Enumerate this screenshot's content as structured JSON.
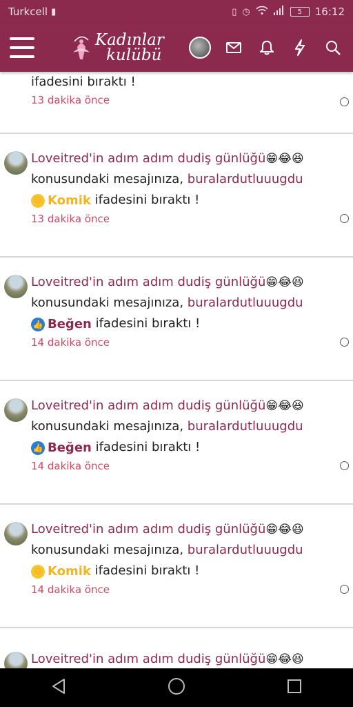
{
  "status": {
    "carrier": "Turkcell",
    "battery": "5",
    "time": "16:12"
  },
  "app": {
    "logo_line1": "Kadınlar",
    "logo_line2": "kulübü"
  },
  "feed": {
    "partial_text": "ifadesini bıraktı !",
    "partial_time": "13 dakika önce",
    "items": [
      {
        "title": "Loveitred'in adım adım dudiş günlüğü",
        "emojis": "😁😂😆",
        "middle": "konusundaki mesajınıza,",
        "user": "buralardutluuugdu",
        "reaction": "Komik",
        "reaction_type": "laugh",
        "suffix": "ifadesini bıraktı !",
        "time": "13 dakika önce"
      },
      {
        "title": "Loveitred'in adım adım dudiş günlüğü",
        "emojis": "😁😂😆",
        "middle": "konusundaki mesajınıza,",
        "user": "buralardutluuugdu",
        "reaction": "Beğen",
        "reaction_type": "like",
        "suffix": "ifadesini bıraktı !",
        "time": "14 dakika önce"
      },
      {
        "title": "Loveitred'in adım adım dudiş günlüğü",
        "emojis": "😁😂😆",
        "middle": "konusundaki mesajınıza,",
        "user": "buralardutluuugdu",
        "reaction": "Beğen",
        "reaction_type": "like",
        "suffix": "ifadesini bıraktı !",
        "time": "14 dakika önce"
      },
      {
        "title": "Loveitred'in adım adım dudiş günlüğü",
        "emojis": "😁😂😆",
        "middle": "konusundaki mesajınıza,",
        "user": "buralardutluuugdu",
        "reaction": "Komik",
        "reaction_type": "laugh",
        "suffix": "ifadesini bıraktı !",
        "time": "14 dakika önce"
      }
    ],
    "last_title": "Loveitred'in adım adım dudiş günlüğü",
    "last_emojis": "😁😂😆"
  },
  "colors": {
    "brand": "#8c2a4e",
    "time": "#c84b61",
    "komik": "#f2b51d",
    "like": "#2a7dd1"
  }
}
